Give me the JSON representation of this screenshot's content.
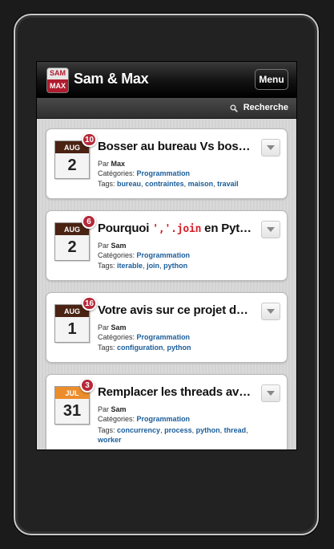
{
  "header": {
    "logo_top": "SAM",
    "logo_bottom": "MAX",
    "title": "Sam & Max",
    "menu_label": "Menu"
  },
  "search": {
    "label": "Recherche"
  },
  "posts": [
    {
      "month": "AUG",
      "day": "2",
      "comments": "10",
      "title": "Bosser au bureau Vs bosser …",
      "author_prefix": "Par",
      "author": "Max",
      "categories_label": "Catégories:",
      "categories": [
        "Programmation"
      ],
      "tags_label": "Tags:",
      "tags": [
        "bureau",
        "contraintes",
        "maison",
        "travail"
      ]
    },
    {
      "month": "AUG",
      "day": "2",
      "comments": "6",
      "title_before": "Pourquoi ",
      "title_code": "','.join",
      "title_after": " en Python ?",
      "author_prefix": "Par",
      "author": "Sam",
      "categories_label": "Catégories:",
      "categories": [
        "Programmation"
      ],
      "tags_label": "Tags:",
      "tags": [
        "iterable",
        "join",
        "python"
      ]
    },
    {
      "month": "AUG",
      "day": "1",
      "comments": "16",
      "title": "Votre avis sur ce projet de lib …",
      "author_prefix": "Par",
      "author": "Sam",
      "categories_label": "Catégories:",
      "categories": [
        "Programmation"
      ],
      "tags_label": "Tags:",
      "tags": [
        "configuration",
        "python"
      ]
    },
    {
      "month": "JUL",
      "day": "31",
      "comments": "3",
      "title": "Remplacer les threads avec l…",
      "author_prefix": "Par",
      "author": "Sam",
      "categories_label": "Catégories:",
      "categories": [
        "Programmation"
      ],
      "tags_label": "Tags:",
      "tags": [
        "concurrency",
        "process",
        "python",
        "thread",
        "worker"
      ]
    }
  ],
  "colors": {
    "month_aug": "#4a2313",
    "month_jul": "#ec8d2b",
    "badge": "#b6293a",
    "link": "#1a5d99"
  }
}
